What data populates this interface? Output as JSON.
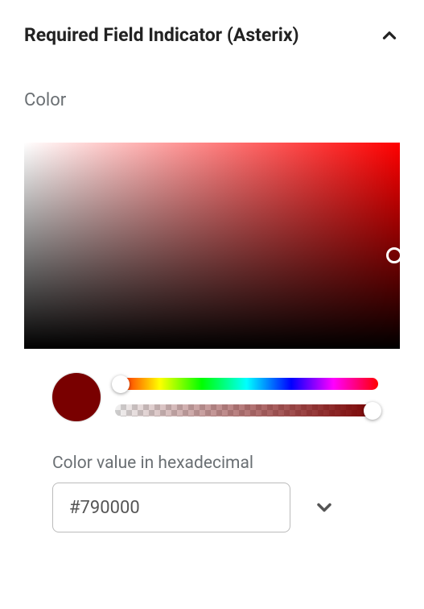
{
  "section": {
    "title": "Required Field Indicator (Asterix)"
  },
  "color": {
    "label": "Color",
    "hex_label": "Color value in hexadecimal",
    "hex_value": "#790000",
    "swatch_hex": "#790000"
  }
}
